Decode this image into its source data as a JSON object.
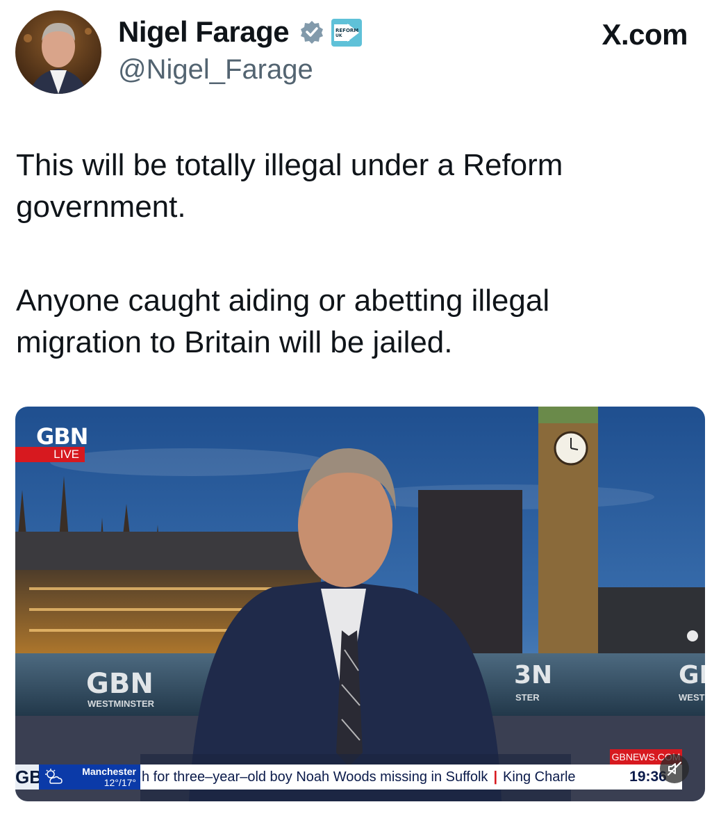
{
  "author": {
    "name": "Nigel Farage",
    "handle": "@Nigel_Farage",
    "party_badge": "REFORM UK"
  },
  "site": "X.com",
  "tweet": {
    "paragraph1": "This will be totally illegal under a Reform government.",
    "paragraph2": "Anyone caught aiding or abetting illegal migration to Britain will be jailed."
  },
  "media": {
    "channel_logo": "GBN",
    "live_label": "LIVE",
    "desk_logo": "GBN",
    "desk_location": "WESTMINSTER",
    "desk_logo_right": "GI",
    "desk_location_right": "WEST",
    "desk_logo_mid": "3N",
    "desk_location_mid": "STER",
    "ticker": {
      "brand": "GB",
      "weather_city": "Manchester",
      "weather_temps": "12°/17°",
      "headline": "h for three–year–old boy Noah Woods missing in Suffolk",
      "separator": "|",
      "next_headline": "King Charle",
      "time": "19:36",
      "site_tag": "GBNEWS.COM"
    }
  },
  "colors": {
    "verified": "#829aab",
    "handle": "#536471",
    "gbnews_red": "#d7191f",
    "gbnews_blue": "#0b3aa8"
  },
  "icons": [
    "verified-badge-icon",
    "reform-uk-badge-icon",
    "weather-icon",
    "mute-icon"
  ]
}
